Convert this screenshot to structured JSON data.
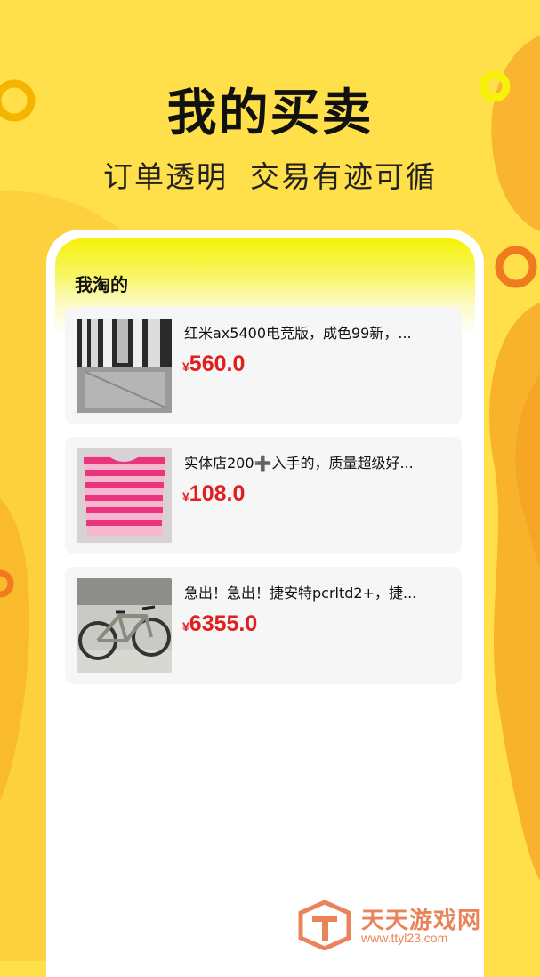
{
  "hero": {
    "title": "我的买卖",
    "subtitle": "订单透明  交易有迹可循"
  },
  "section": {
    "title": "我淘的"
  },
  "items": [
    {
      "title": "红米ax5400电竞版，成色99新，...",
      "currency": "¥",
      "price": "560.0",
      "image": "router-box-photo"
    },
    {
      "title": "实体店200➕入手的，质量超级好...",
      "currency": "¥",
      "price": "108.0",
      "image": "pink-striped-sweater-photo"
    },
    {
      "title": "急出！急出！捷安特pcrltd2+，捷...",
      "currency": "¥",
      "price": "6355.0",
      "image": "road-bike-photo"
    }
  ],
  "watermark": {
    "name": "天天游戏网",
    "url": "www.ttyl23.com"
  },
  "colors": {
    "background": "#FFE04A",
    "accent_orange": "#F5A623",
    "price_red": "#E02020",
    "header_yellow": "#F5F20A"
  }
}
